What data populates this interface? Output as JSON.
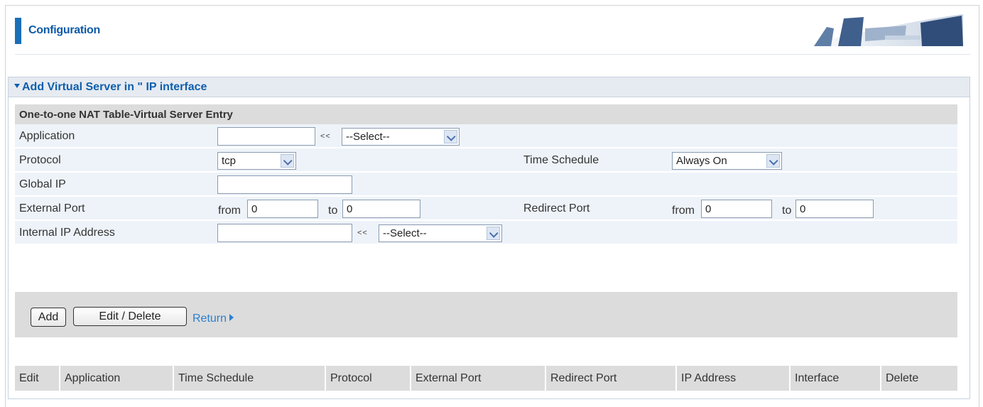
{
  "header": {
    "title": "Configuration"
  },
  "panel": {
    "title": "Add Virtual Server in \" IP interface"
  },
  "section": {
    "title": "One-to-one NAT Table-Virtual Server Entry"
  },
  "form": {
    "application": {
      "label": "Application",
      "value": "",
      "select": "--Select--"
    },
    "protocol": {
      "label": "Protocol",
      "select": "tcp"
    },
    "time_schedule": {
      "label": "Time Schedule",
      "select": "Always On"
    },
    "global_ip": {
      "label": "Global IP",
      "value": ""
    },
    "external_port": {
      "label": "External Port",
      "from_label": "from",
      "from": "0",
      "to_label": "to",
      "to": "0"
    },
    "redirect_port": {
      "label": "Redirect Port",
      "from_label": "from",
      "from": "0",
      "to_label": "to",
      "to": "0"
    },
    "internal_ip": {
      "label": "Internal IP Address",
      "value": "",
      "select": "--Select--"
    },
    "arrows": "<<"
  },
  "buttons": {
    "add": "Add",
    "edit_delete": "Edit / Delete",
    "return": "Return"
  },
  "table": {
    "columns": [
      "Edit",
      "Application",
      "Time Schedule",
      "Protocol",
      "External Port",
      "Redirect Port",
      "IP Address",
      "Interface",
      "Delete"
    ]
  },
  "colors": {
    "accent": "#1a6fb8",
    "title": "#0d5aa7",
    "link": "#2c7fd0",
    "row_bg": "#eef3f9",
    "gray": "#dcdcdc"
  }
}
